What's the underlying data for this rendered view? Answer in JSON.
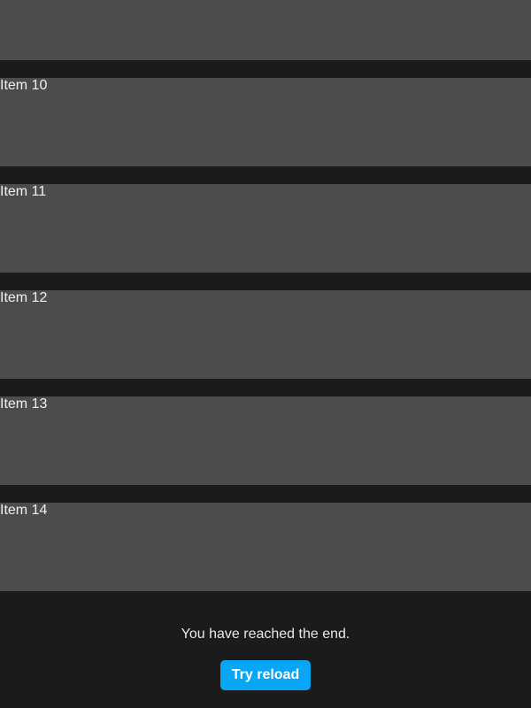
{
  "list": {
    "items": [
      {
        "label": ""
      },
      {
        "label": "Item 10"
      },
      {
        "label": "Item 11"
      },
      {
        "label": "Item 12"
      },
      {
        "label": "Item 13"
      },
      {
        "label": "Item 14"
      }
    ]
  },
  "footer": {
    "message": "You have reached the end.",
    "reload_label": "Try reload"
  },
  "colors": {
    "background": "#1b1b1b",
    "item_background": "#4c4c4c",
    "accent": "#0aa6f6"
  }
}
